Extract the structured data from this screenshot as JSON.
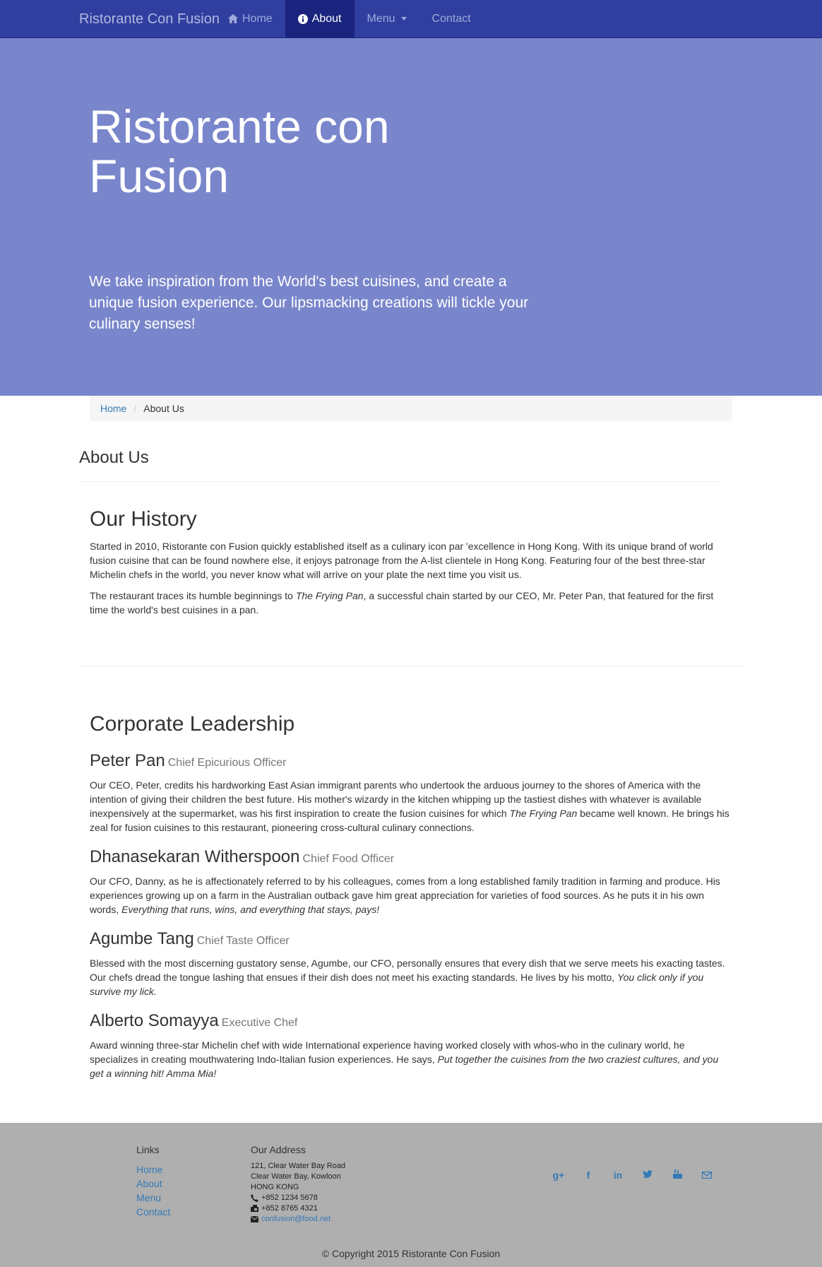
{
  "navbar": {
    "brand": "Ristorante Con Fusion",
    "items": [
      {
        "label": "Home",
        "icon": "home-icon"
      },
      {
        "label": "About",
        "icon": "info-icon",
        "active": true
      },
      {
        "label": "Menu",
        "icon": "caret-down-icon"
      },
      {
        "label": "Contact"
      }
    ]
  },
  "jumbotron": {
    "title": "Ristorante con Fusion",
    "text": "We take inspiration from the World's best cuisines, and create a unique fusion experience. Our lipsmacking creations will tickle your culinary senses!"
  },
  "breadcrumb": {
    "home": "Home",
    "current": "About Us"
  },
  "page_heading": "About Us",
  "history": {
    "title": "Our History",
    "para1": "Started in 2010, Ristorante con Fusion quickly established itself as a culinary icon par 'excellence in Hong Kong. With its unique brand of world fusion cuisine that can be found nowhere else, it enjoys patronage from the A-list clientele in Hong Kong. Featuring four of the best three-star Michelin chefs in the world, you never know what will arrive on your plate the next time you visit us.",
    "para2_a": "The restaurant traces its humble beginnings to ",
    "para2_em": "The Frying Pan",
    "para2_b": ", a successful chain started by our CEO, Mr. Peter Pan, that featured for the first time the world's best cuisines in a pan."
  },
  "leadership": {
    "title": "Corporate Leadership",
    "leaders": [
      {
        "name": "Peter Pan",
        "role": "Chief Epicurious Officer",
        "text_a": "Our CEO, Peter, credits his hardworking East Asian immigrant parents who undertook the arduous journey to the shores of America with the intention of giving their children the best future. His mother's wizardy in the kitchen whipping up the tastiest dishes with whatever is available inexpensively at the supermarket, was his first inspiration to create the fusion cuisines for which ",
        "text_em": "The Frying Pan",
        "text_b": " became well known. He brings his zeal for fusion cuisines to this restaurant, pioneering cross-cultural culinary connections."
      },
      {
        "name": "Dhanasekaran Witherspoon",
        "role": "Chief Food Officer",
        "text_a": "Our CFO, Danny, as he is affectionately referred to by his colleagues, comes from a long established family tradition in farming and produce. His experiences growing up on a farm in the Australian outback gave him great appreciation for varieties of food sources. As he puts it in his own words, ",
        "text_em": "Everything that runs, wins, and everything that stays, pays!",
        "text_b": ""
      },
      {
        "name": "Agumbe Tang",
        "role": "Chief Taste Officer",
        "text_a": "Blessed with the most discerning gustatory sense, Agumbe, our CFO, personally ensures that every dish that we serve meets his exacting tastes. Our chefs dread the tongue lashing that ensues if their dish does not meet his exacting standards. He lives by his motto, ",
        "text_em": "You click only if you survive my lick.",
        "text_b": ""
      },
      {
        "name": "Alberto Somayya",
        "role": "Executive Chef",
        "text_a": "Award winning three-star Michelin chef with wide International experience having worked closely with whos-who in the culinary world, he specializes in creating mouthwatering Indo-Italian fusion experiences. He says, ",
        "text_em": "Put together the cuisines from the two craziest cultures, and you get a winning hit! Amma Mia!",
        "text_b": ""
      }
    ]
  },
  "footer": {
    "links_title": "Links",
    "links": [
      "Home",
      "About",
      "Menu",
      "Contact"
    ],
    "address_title": "Our Address",
    "address_lines": [
      "121, Clear Water Bay Road",
      "Clear Water Bay, Kowloon",
      "HONG KONG"
    ],
    "phone": "+852 1234 5678",
    "fax": "+852 8765 4321",
    "email": "confusion@food.net",
    "social_icons": [
      "google-plus-icon",
      "facebook-icon",
      "linkedin-icon",
      "twitter-icon",
      "youtube-icon",
      "mail-icon"
    ],
    "copyright": "© Copyright 2015 Ristorante Con Fusion"
  },
  "colors": {
    "navbar": "#303f9f",
    "navbar_active": "#1a237e",
    "jumbotron": "#7986cb",
    "footer": "#afafaf",
    "link": "#337ab7"
  }
}
